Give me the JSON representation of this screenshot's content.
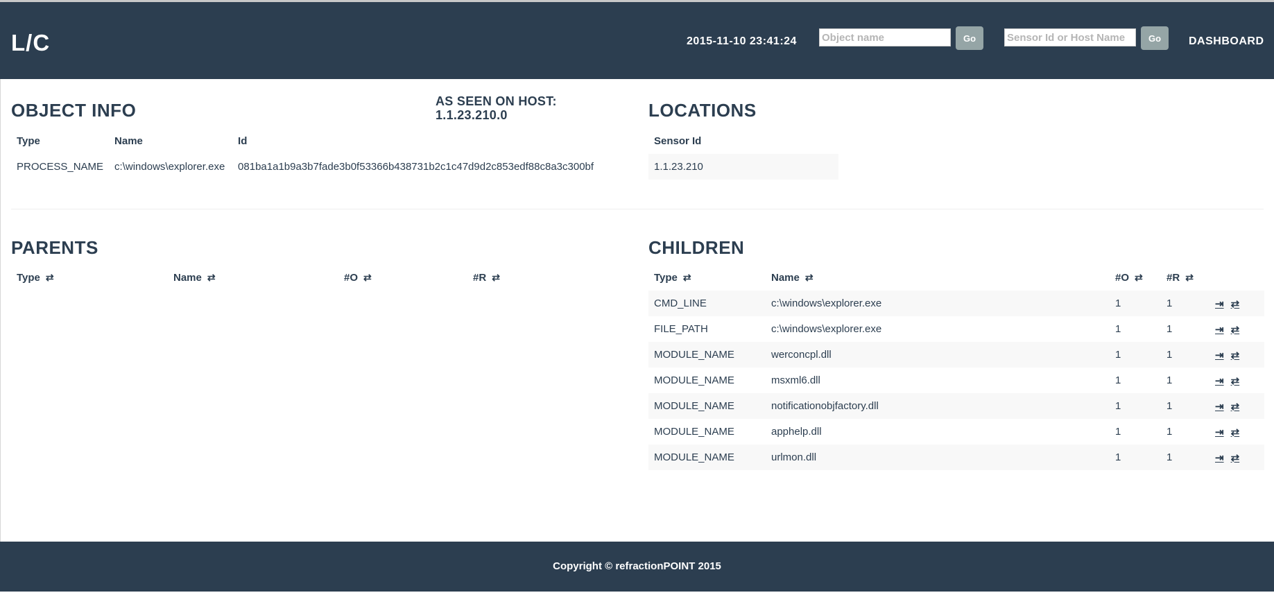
{
  "header": {
    "logo": "L/C",
    "datetime": "2015-11-10 23:41:24",
    "object_search_placeholder": "Object name",
    "object_go": "Go",
    "sensor_search_placeholder": "Sensor Id or Host Name",
    "sensor_go": "Go",
    "dashboard": "DASHBOARD"
  },
  "object_info": {
    "title": "OBJECT INFO",
    "columns": [
      "Type",
      "Name",
      "Id"
    ],
    "row": {
      "type": "PROCESS_NAME",
      "name": "c:\\windows\\explorer.exe",
      "id": "081ba1a1b9a3b7fade3b0f53366b438731b2c1c47d9d2c853edf88c8a3c300bf"
    }
  },
  "host": {
    "label": "AS SEEN ON HOST:",
    "value": "1.1.23.210.0"
  },
  "locations": {
    "title": "LOCATIONS",
    "column": "Sensor Id",
    "rows": [
      "1.1.23.210"
    ]
  },
  "parents": {
    "title": "PARENTS",
    "columns": [
      "Type",
      "Name",
      "#O",
      "#R"
    ]
  },
  "children": {
    "title": "CHILDREN",
    "columns": [
      "Type",
      "Name",
      "#O",
      "#R"
    ],
    "rows": [
      {
        "type": "CMD_LINE",
        "name": "c:\\windows\\explorer.exe",
        "o": "1",
        "r": "1"
      },
      {
        "type": "FILE_PATH",
        "name": "c:\\windows\\explorer.exe",
        "o": "1",
        "r": "1"
      },
      {
        "type": "MODULE_NAME",
        "name": "werconcpl.dll",
        "o": "1",
        "r": "1"
      },
      {
        "type": "MODULE_NAME",
        "name": "msxml6.dll",
        "o": "1",
        "r": "1"
      },
      {
        "type": "MODULE_NAME",
        "name": "notificationobjfactory.dll",
        "o": "1",
        "r": "1"
      },
      {
        "type": "MODULE_NAME",
        "name": "apphelp.dll",
        "o": "1",
        "r": "1"
      },
      {
        "type": "MODULE_NAME",
        "name": "urlmon.dll",
        "o": "1",
        "r": "1"
      }
    ]
  },
  "icons": {
    "sort": "sort-icon",
    "view_object": "login-icon",
    "explore_relations": "transfer-icon"
  },
  "colors": {
    "header_bg": "#2c3e50",
    "go_button": "#95a5a6",
    "text": "#2c3e50",
    "stripe": "#f8f8f8"
  },
  "footer": {
    "copyright": "Copyright © refractionPOINT 2015"
  }
}
